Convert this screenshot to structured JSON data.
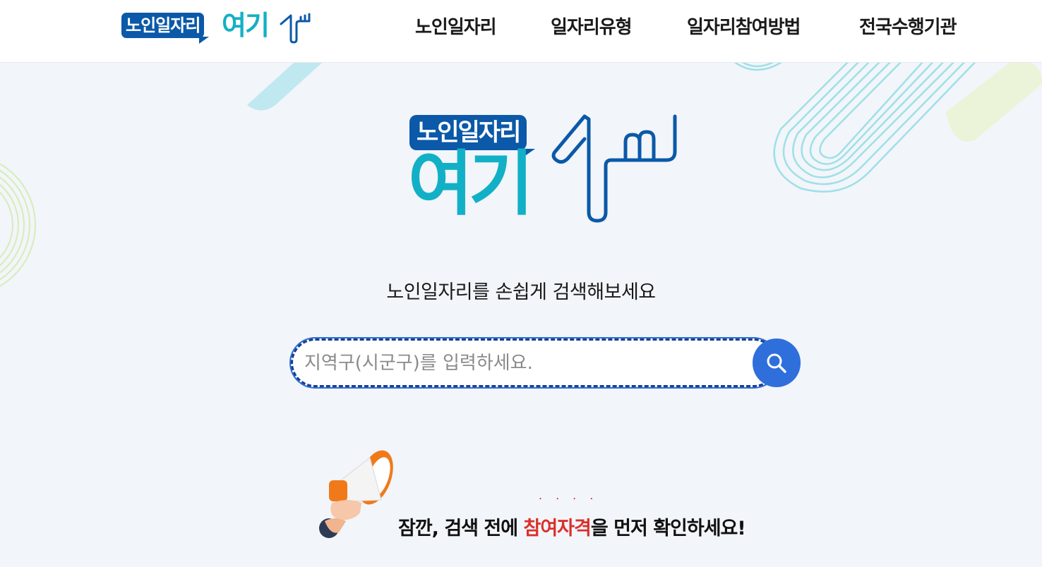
{
  "header": {
    "logo": {
      "badge": "노인일자리",
      "word": "여기"
    },
    "nav": [
      {
        "label": "노인일자리"
      },
      {
        "label": "일자리유형"
      },
      {
        "label": "일자리참여방법"
      },
      {
        "label": "전국수행기관"
      }
    ]
  },
  "hero": {
    "logo": {
      "badge": "노인일자리",
      "word": "여기"
    },
    "tagline": "노인일자리를 손쉽게 검색해보세요",
    "search": {
      "placeholder": "지역구(시군구)를 입력하세요.",
      "value": ""
    },
    "notice": {
      "before": "잠깐, 검색 전에 ",
      "highlight": "참여자격",
      "after": "을 먼저 확인하세요!"
    }
  },
  "colors": {
    "brand_blue": "#0b59a8",
    "brand_teal": "#12b0c6",
    "button_blue": "#2f6fdc",
    "highlight_red": "#d9302c",
    "background": "#f2f5f9"
  },
  "icons": [
    "pointing-hand-icon",
    "search-icon",
    "megaphone-icon"
  ]
}
